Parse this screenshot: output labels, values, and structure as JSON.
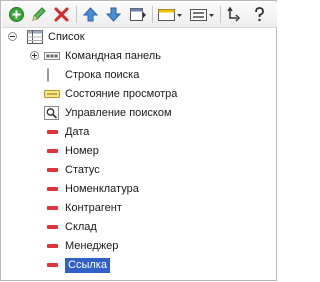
{
  "toolbar": {
    "buttons": [
      "add-icon",
      "edit-icon",
      "delete-icon",
      "move-up-icon",
      "move-down-icon",
      "form-properties-icon",
      "appearance-dropdown-icon",
      "group-dropdown-icon",
      "swap-icon",
      "help-icon"
    ]
  },
  "tree": {
    "root_label": "Список",
    "items": [
      {
        "label": "Командная панель",
        "type": "command-panel"
      },
      {
        "label": "Строка поиска",
        "type": "search-string"
      },
      {
        "label": "Состояние просмотра",
        "type": "view-status"
      },
      {
        "label": "Управление поиском",
        "type": "search-control"
      },
      {
        "label": "Дата",
        "type": "field"
      },
      {
        "label": "Номер",
        "type": "field"
      },
      {
        "label": "Статус",
        "type": "field"
      },
      {
        "label": "Номенклатура",
        "type": "field"
      },
      {
        "label": "Контрагент",
        "type": "field"
      },
      {
        "label": "Склад",
        "type": "field"
      },
      {
        "label": "Менеджер",
        "type": "field"
      },
      {
        "label": "Ссылка",
        "type": "field",
        "selected": true
      }
    ]
  },
  "colors": {
    "field_marker": "#e2333b",
    "selection": "#3161c7"
  }
}
